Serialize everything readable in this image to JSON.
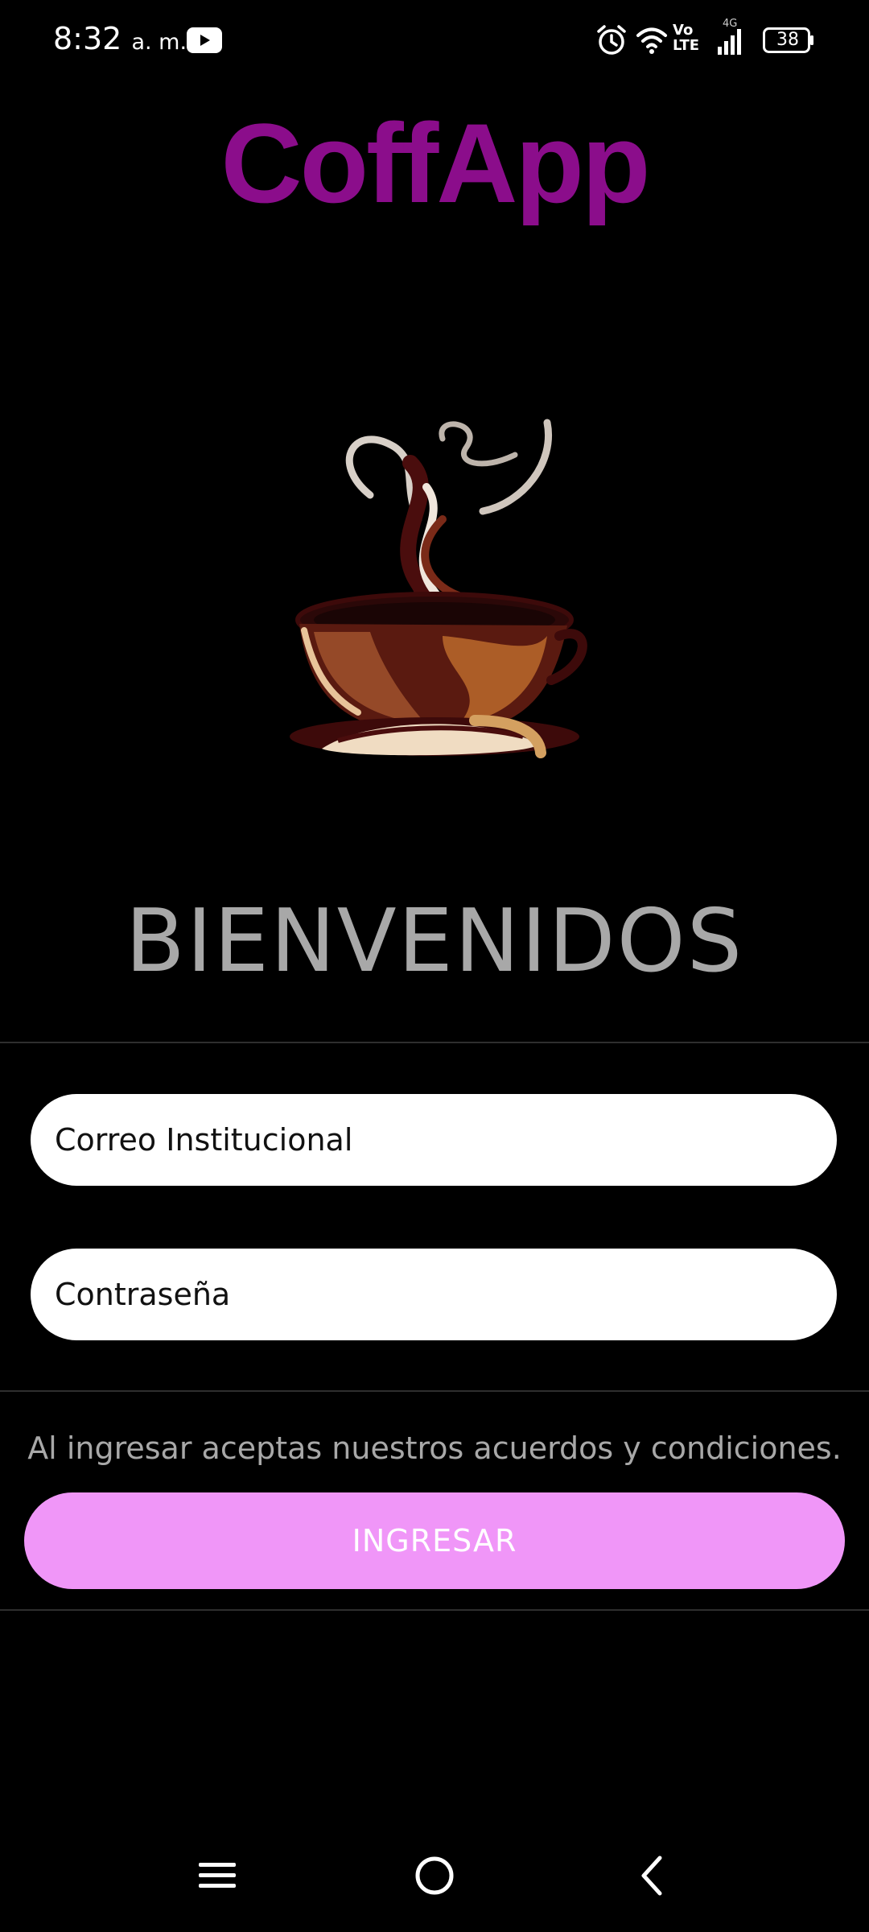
{
  "status_bar": {
    "time": "8:32",
    "ampm": "a. m.",
    "volte_line1": "Vo",
    "volte_line2": "LTE",
    "network": "4G",
    "battery": "38"
  },
  "app": {
    "title": "CoffApp",
    "welcome": "BIENVENIDOS"
  },
  "form": {
    "email_placeholder": "Correo Institucional",
    "password_placeholder": "Contraseña",
    "terms_text": "Al ingresar aceptas nuestros acuerdos y condiciones.",
    "login_label": "INGRESAR"
  },
  "colors": {
    "title": "#8b0d8b",
    "button": "#f096f8",
    "welcome_text": "#a8a8a8"
  },
  "nav_bar": {
    "icons": [
      "menu-icon",
      "home-circle-icon",
      "back-chevron-icon"
    ]
  }
}
